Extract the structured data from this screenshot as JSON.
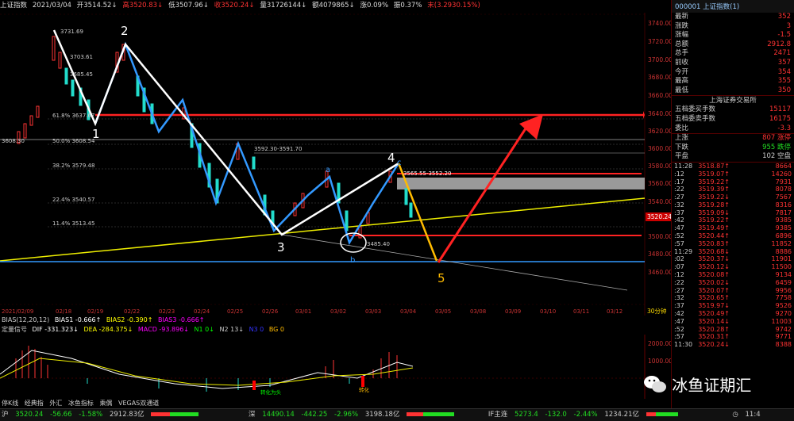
{
  "topbar": {
    "title": "上证指数",
    "date": "2021/03/04",
    "open": "开3514.52↓",
    "high": "高3520.83↓",
    "low": "低3507.96↓",
    "close": "收3520.24↓",
    "vol": "量31726144↓",
    "amount": "额4079865↓",
    "change": "涨0.09%",
    "amp": "振0.37%",
    "extra": "末(3.2930.15%)"
  },
  "chart": {
    "price_labels": [
      "3740.00",
      "3720.00",
      "3700.00",
      "3680.00",
      "3660.00",
      "3640.00",
      "3620.00",
      "3600.00",
      "3580.00",
      "3560.00",
      "3540.00",
      "3520.00",
      "3500.00",
      "3480.00",
      "3460.00"
    ],
    "dates": [
      "2021/02/09",
      "02/18",
      "02/19",
      "02/22",
      "02/23",
      "02/24",
      "02/25",
      "02/26",
      "03/01",
      "03/02",
      "03/03",
      "03/04",
      "03/05",
      "03/08",
      "03/09",
      "03/10",
      "03/11",
      "03/12"
    ],
    "period_label": "30分钟",
    "fib_labels": [
      "61.8% 3637.67",
      "50.0% 3608.54",
      "38.2% 3579.48",
      "22.4% 3540.57",
      "11.4% 3513.45"
    ],
    "high_label": "3731.69",
    "left_price": "3608.30",
    "mid_labels": [
      "3703.61",
      "3685.45",
      "3592.30-3591.70",
      "3565.55-3552.20",
      "3485.40"
    ],
    "current_price_tag": "3520.24",
    "wave_labels": [
      "1",
      "2",
      "3",
      "4",
      "5",
      "a",
      "b",
      "c"
    ],
    "macd_labels": [
      "2000.00",
      "1000.00",
      "0"
    ],
    "macd_markers": [
      "转化为头",
      "转化"
    ]
  },
  "bias_bar": {
    "name": "BIAS(12,20,12)",
    "b1": "BIAS1 -0.666↑",
    "b2": "BIAS2 -0.390↑",
    "b3": "BIAS3 -0.666↑"
  },
  "indicator_bar": {
    "name": "定量信号",
    "dif": "DIF -331.323↓",
    "dea": "DEA -284.375↓",
    "macd": "MACD -93.896↓",
    "n1": "N1 0↓",
    "n2": "N2 13↓",
    "n3": "N3 0",
    "bg": "BG 0"
  },
  "tabs": [
    "停K线",
    "经典指",
    "外汇",
    "冰鱼指标",
    "乘偶",
    "VEGAS双通道"
  ],
  "right_panel": {
    "header": "000001 上证指数(1)",
    "quote_rows": [
      {
        "k": "最新",
        "v": "352"
      },
      {
        "k": "涨跌",
        "v": "3"
      },
      {
        "k": "涨幅",
        "v": "-1.5"
      },
      {
        "k": "总额",
        "v": "2912.8"
      },
      {
        "k": "总手",
        "v": "2471"
      },
      {
        "k": "前收",
        "v": "357"
      },
      {
        "k": "今开",
        "v": "354"
      },
      {
        "k": "最高",
        "v": "355"
      },
      {
        "k": "最低",
        "v": "350"
      }
    ],
    "section_title": "上海证券交易所",
    "exchange_rows": [
      {
        "k": "五档委买手数",
        "v": "15117"
      },
      {
        "k": "五档委卖手数",
        "v": "16175"
      },
      {
        "k": "委比",
        "v": "-3.3"
      }
    ],
    "breadth_rows": [
      {
        "k": "上涨",
        "v": "807 涨停"
      },
      {
        "k": "下跌",
        "v": "955 跌停"
      },
      {
        "k": "平盘",
        "v": "102 空盘"
      }
    ],
    "ticks": [
      {
        "t": "11:28",
        "p": "3518.87↑",
        "v": "8664"
      },
      {
        "t": ":12",
        "p": "3519.07↑",
        "v": "14260"
      },
      {
        "t": ":17",
        "p": "3519.22↑",
        "v": "7931"
      },
      {
        "t": ":22",
        "p": "3519.39↑",
        "v": "8078"
      },
      {
        "t": ":27",
        "p": "3519.22↓",
        "v": "7567"
      },
      {
        "t": ":32",
        "p": "3519.28↑",
        "v": "8316"
      },
      {
        "t": ":37",
        "p": "3519.09↓",
        "v": "7817"
      },
      {
        "t": ":42",
        "p": "3519.22↑",
        "v": "9385"
      },
      {
        "t": ":47",
        "p": "3519.49↑",
        "v": "9385"
      },
      {
        "t": ":52",
        "p": "3520.44↑",
        "v": "6896"
      },
      {
        "t": ":57",
        "p": "3520.83↑",
        "v": "11852"
      },
      {
        "t": "11:29",
        "p": "3520.68↓",
        "v": "8886"
      },
      {
        "t": ":02",
        "p": "3520.37↓",
        "v": "11901"
      },
      {
        "t": ":07",
        "p": "3520.12↓",
        "v": "11500"
      },
      {
        "t": ":12",
        "p": "3520.08↑",
        "v": "9134"
      },
      {
        "t": ":22",
        "p": "3520.02↓",
        "v": "6459"
      },
      {
        "t": ":27",
        "p": "3520.07↑",
        "v": "9956"
      },
      {
        "t": ":32",
        "p": "3520.65↑",
        "v": "7758"
      },
      {
        "t": ":37",
        "p": "3519.97↓",
        "v": "9526"
      },
      {
        "t": ":42",
        "p": "3520.49↑",
        "v": "9270"
      },
      {
        "t": ":47",
        "p": "3520.14↓",
        "v": "11003"
      },
      {
        "t": ":52",
        "p": "3520.28↑",
        "v": "9742"
      },
      {
        "t": ":57",
        "p": "3520.31↑",
        "v": "9771"
      },
      {
        "t": "11:30",
        "p": "3520.24↓",
        "v": "8388"
      }
    ]
  },
  "bottombar": {
    "sh": "沪",
    "sh_price": "3520.24",
    "sh_chg": "-56.66",
    "sh_pct": "-1.58%",
    "sh_amt": "2912.83亿",
    "sz": "深",
    "sz_price": "14490.14",
    "sz_chg": "-442.25",
    "sz_pct": "-2.96%",
    "sz_amt": "3198.18亿",
    "if": "IF主连",
    "if_price": "5273.4",
    "if_chg": "-132.0",
    "if_pct": "-2.44%",
    "if_amt": "1234.21亿",
    "time": "11:4"
  },
  "watermark": "冰鱼证期汇"
}
